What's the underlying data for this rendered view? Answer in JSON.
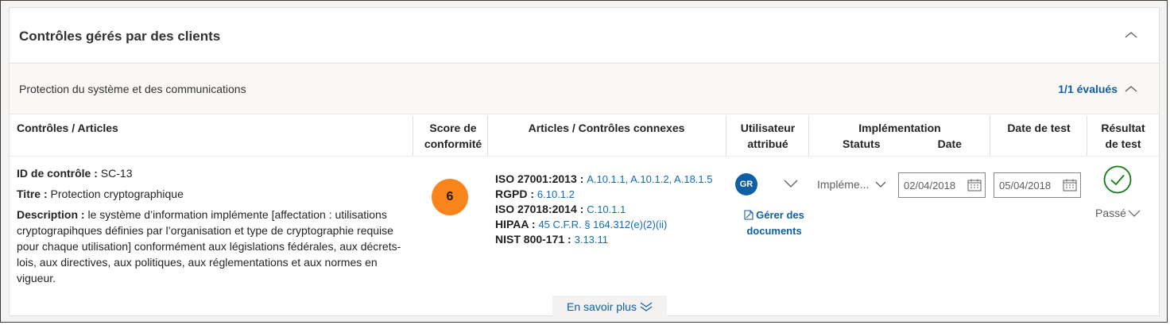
{
  "section": {
    "title": "Contrôles gérés par des clients"
  },
  "family": {
    "name": "Protection du système et des communications",
    "evaluated": "1/1 évalués"
  },
  "columns": {
    "controls": "Contrôles / Articles",
    "score_line1": "Score de",
    "score_line2": "conformité",
    "related": "Articles / Contrôles connexes",
    "user_line1": "Utilisateur",
    "user_line2": "attribué",
    "impl": "Implémentation",
    "impl_status": "Statuts",
    "impl_date": "Date",
    "test_date": "Date de test",
    "result_line1": "Résultat",
    "result_line2": "de test"
  },
  "control": {
    "id_label": "ID de contrôle :",
    "id": "SC-13",
    "title_label": "Titre :",
    "title": "Protection cryptographique",
    "desc_label": "Description :",
    "desc": "le système d’information implémente [affectation : utilisations cryptograpihques définies par l’organisation et type de cryptographie requise pour chaque utilisation] conformément aux législations fédérales, aux décrets-lois, aux directives, aux politiques, aux réglementations et aux normes en vigueur.",
    "score": "6",
    "score_color": "#f7851c",
    "related": [
      {
        "standard": "ISO 27001:2013 :",
        "refs": "A.10.1.1, A.10.1.2, A.18.1.5"
      },
      {
        "standard": "RGPD :",
        "refs": "6.10.1.2"
      },
      {
        "standard": "ISO 27018:2014 :",
        "refs": "C.10.1.1"
      },
      {
        "standard": "HIPAA :",
        "refs": "45 C.F.R. § 164.312(e)(2)(ii)"
      },
      {
        "standard": "NIST 800-171 :",
        "refs": "3.13.11"
      }
    ],
    "more": "En savoir plus",
    "user_initials": "GR",
    "manage_docs": "Gérer des documents",
    "impl_status": "Impléme...",
    "impl_date": "02/04/2018",
    "test_date": "05/04/2018",
    "result": "Passé",
    "result_icon": "check-circle-icon"
  },
  "colors": {
    "link": "#0f6cbd",
    "accent": "#0f5ea6",
    "pass": "#107c10"
  }
}
